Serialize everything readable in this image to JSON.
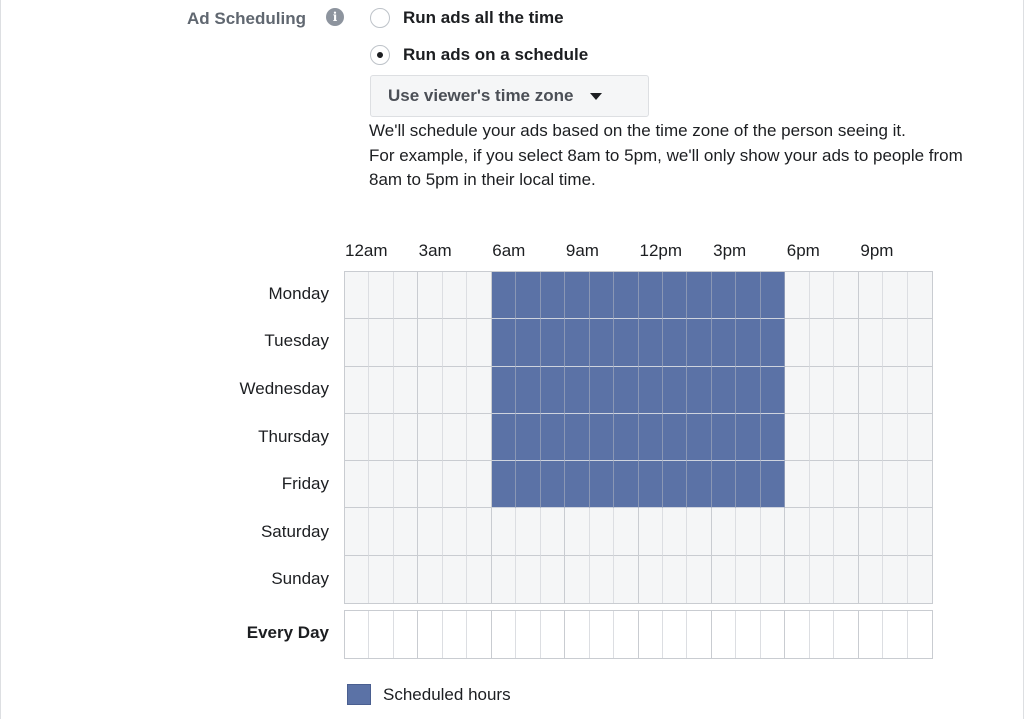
{
  "section": {
    "label": "Ad Scheduling",
    "info_icon": "info-circle-icon"
  },
  "options": [
    {
      "label": "Run ads all the time",
      "selected": false
    },
    {
      "label": "Run ads on a schedule",
      "selected": true
    }
  ],
  "timezone_select": {
    "value": "Use viewer's time zone",
    "icon": "caret-down-icon"
  },
  "description": {
    "line1": "We'll schedule your ads based on the time zone of the person seeing it.",
    "line2": "For example, if you select 8am to 5pm, we'll only show your ads to people from 8am to 5pm in their local time."
  },
  "schedule": {
    "hour_labels": [
      "12am",
      "3am",
      "6am",
      "9am",
      "12pm",
      "3pm",
      "6pm",
      "9pm"
    ],
    "days": [
      {
        "label": "Monday",
        "active_hours": [
          6,
          7,
          8,
          9,
          10,
          11,
          12,
          13,
          14,
          15,
          16,
          17
        ]
      },
      {
        "label": "Tuesday",
        "active_hours": [
          6,
          7,
          8,
          9,
          10,
          11,
          12,
          13,
          14,
          15,
          16,
          17
        ]
      },
      {
        "label": "Wednesday",
        "active_hours": [
          6,
          7,
          8,
          9,
          10,
          11,
          12,
          13,
          14,
          15,
          16,
          17
        ]
      },
      {
        "label": "Thursday",
        "active_hours": [
          6,
          7,
          8,
          9,
          10,
          11,
          12,
          13,
          14,
          15,
          16,
          17
        ]
      },
      {
        "label": "Friday",
        "active_hours": [
          6,
          7,
          8,
          9,
          10,
          11,
          12,
          13,
          14,
          15,
          16,
          17
        ]
      },
      {
        "label": "Saturday",
        "active_hours": []
      },
      {
        "label": "Sunday",
        "active_hours": []
      }
    ],
    "every_day": {
      "label": "Every Day",
      "active_hours": []
    }
  },
  "legend": {
    "label": "Scheduled hours",
    "color": "#5b72a6"
  }
}
